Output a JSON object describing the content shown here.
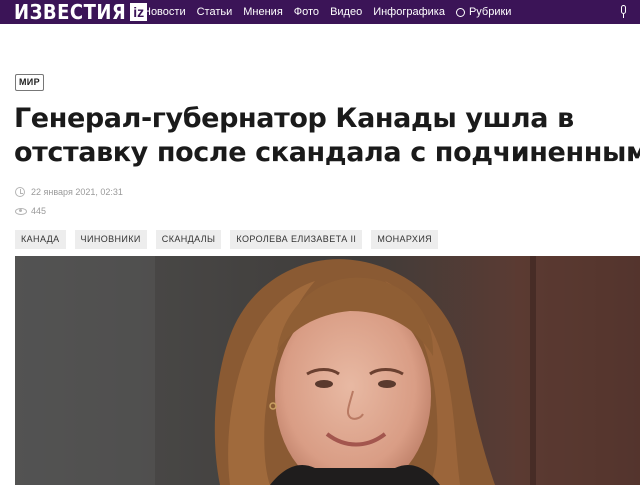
{
  "header": {
    "logo_text": "ИЗВЕСТИЯ",
    "logo_badge": "iz",
    "nav": [
      "Новости",
      "Статьи",
      "Мнения",
      "Фото",
      "Видео",
      "Инфографика"
    ],
    "rubriki_label": "Рубрики",
    "rubriki_icon": "circle-check-icon",
    "mic_icon": "microphone-icon",
    "background_color": "#3b1457"
  },
  "article": {
    "section": "МИР",
    "title_line1": "Генерал-губернатор Канады ушла в",
    "title_line2": "отставку после скандала с подчиненными",
    "date": "22 января 2021, 02:31",
    "views": "445",
    "tags": [
      "КАНАДА",
      "ЧИНОВНИКИ",
      "СКАНДАЛЫ",
      "КОРОЛЕВА ЕЛИЗАВЕТА II",
      "МОНАРХИЯ"
    ],
    "photo_subject": "portrait-photo"
  }
}
